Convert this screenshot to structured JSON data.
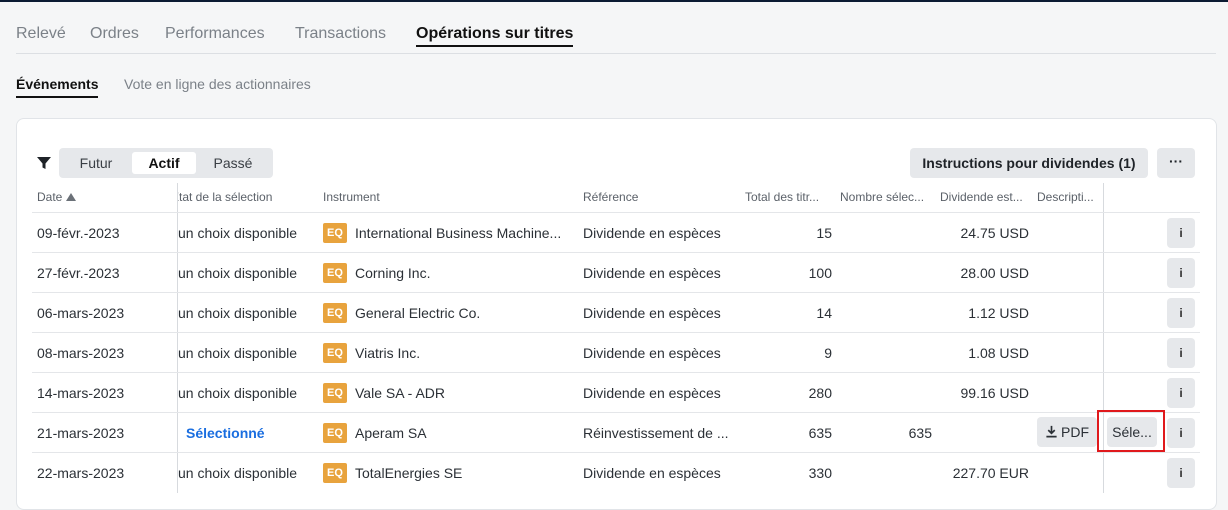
{
  "main_tabs": [
    "Relevé",
    "Ordres",
    "Performances",
    "Transactions",
    "Opérations sur titres"
  ],
  "sub_tabs": [
    "Événements",
    "Vote en ligne des actionnaires"
  ],
  "filter": {
    "options": [
      "Futur",
      "Actif",
      "Passé"
    ],
    "active": "Actif"
  },
  "toolbar": {
    "dividend_instructions": "Instructions pour dividendes (1)",
    "more": "···"
  },
  "columns": {
    "date": "Date",
    "state": "État de la sélection",
    "instrument": "Instrument",
    "reference": "Référence",
    "total": "Total des titr...",
    "selected_count": "Nombre sélec...",
    "dividend": "Dividende est...",
    "description": "Descripti..."
  },
  "rows": [
    {
      "date": "09-févr.-2023",
      "state": "un choix disponible",
      "type": "EQ",
      "instrument": "International Business Machine...",
      "reference": "Dividende en espèces",
      "total": "15",
      "selected": "",
      "dividend": "24.75 USD",
      "info": "i"
    },
    {
      "date": "27-févr.-2023",
      "state": "un choix disponible",
      "type": "EQ",
      "instrument": "Corning Inc.",
      "reference": "Dividende en espèces",
      "total": "100",
      "selected": "",
      "dividend": "28.00 USD",
      "info": "i"
    },
    {
      "date": "06-mars-2023",
      "state": "un choix disponible",
      "type": "EQ",
      "instrument": "General Electric Co.",
      "reference": "Dividende en espèces",
      "total": "14",
      "selected": "",
      "dividend": "1.12 USD",
      "info": "i"
    },
    {
      "date": "08-mars-2023",
      "state": "un choix disponible",
      "type": "EQ",
      "instrument": "Viatris Inc.",
      "reference": "Dividende en espèces",
      "total": "9",
      "selected": "",
      "dividend": "1.08 USD",
      "info": "i"
    },
    {
      "date": "14-mars-2023",
      "state": "un choix disponible",
      "type": "EQ",
      "instrument": "Vale SA - ADR",
      "reference": "Dividende en espèces",
      "total": "280",
      "selected": "",
      "dividend": "99.16 USD",
      "info": "i"
    },
    {
      "date": "21-mars-2023",
      "state": "Sélectionné",
      "type": "EQ",
      "instrument": "Aperam SA",
      "reference": "Réinvestissement de ...",
      "total": "635",
      "selected": "635",
      "dividend": "",
      "pdf": "PDF",
      "select": "Séle...",
      "info": "i"
    },
    {
      "date": "22-mars-2023",
      "state": "un choix disponible",
      "type": "EQ",
      "instrument": "TotalEnergies SE",
      "reference": "Dividende en espèces",
      "total": "330",
      "selected": "",
      "dividend": "227.70 EUR",
      "info": "i"
    }
  ],
  "colors": {
    "eq_badge": "#e8a33d",
    "selected_state": "#1a6ee0",
    "highlight": "#e0191c"
  }
}
